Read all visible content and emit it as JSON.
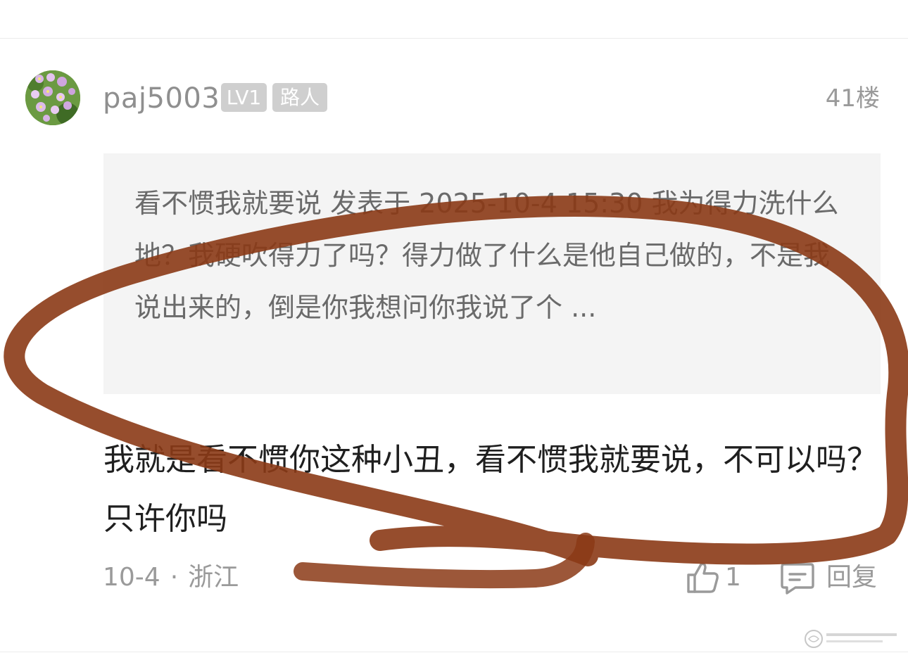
{
  "comment": {
    "username": "paj5003",
    "level_badge": "LV1",
    "rank_badge": "路人",
    "floor": "41楼",
    "quote": {
      "text": "看不惯我就要说 发表于 2025-10-4 15:30 我为得力洗什么地？我硬吹得力了吗？得力做了什么是他自己做的，不是我说出来的，倒是你我想问你我说了个 ..."
    },
    "body": "我就是看不惯你这种小丑，看不惯我就要说，不可以吗？只许你吗",
    "date": "10-4",
    "separator": "·",
    "location": "浙江",
    "like_count": "1",
    "reply_label": "回复"
  },
  "icons": {
    "like": "thumbs-up-icon",
    "reply": "comment-icon",
    "avatar": "flower-avatar"
  },
  "colors": {
    "annotation_stroke": "#8b3a16",
    "badge_bg": "#cfcfcf",
    "quote_bg": "#f4f4f4",
    "muted_text": "#9a9a9a",
    "body_text": "#1f1f1f"
  }
}
